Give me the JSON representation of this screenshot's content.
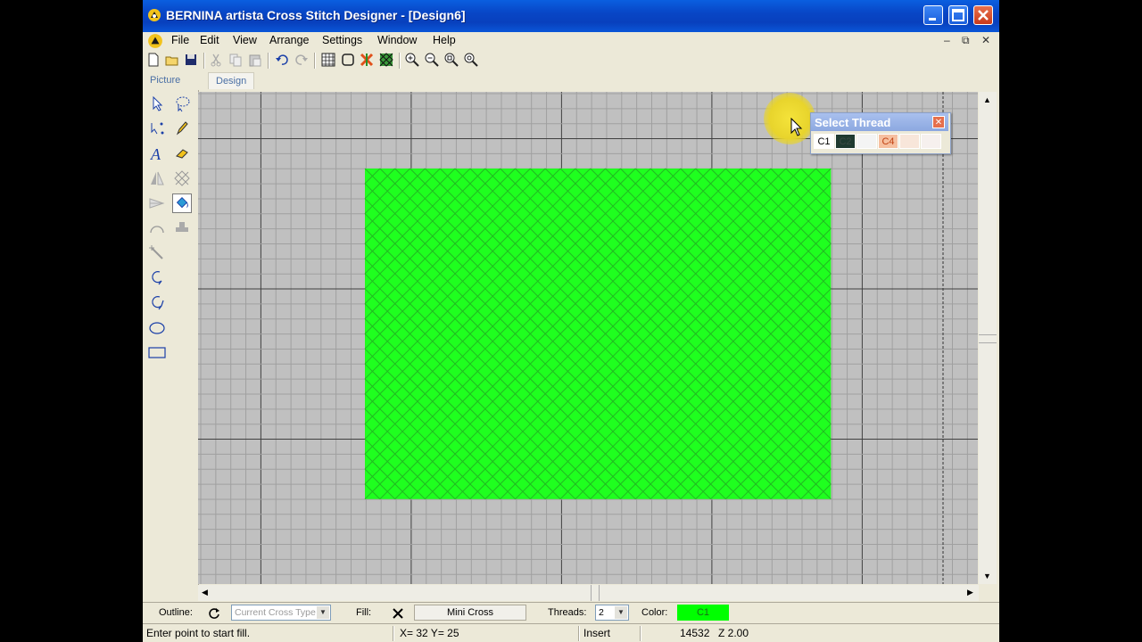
{
  "window": {
    "title": "BERNINA artista Cross Stitch Designer - [Design6]"
  },
  "menu": [
    "File",
    "Edit",
    "View",
    "Arrange",
    "Settings",
    "Window",
    "Help"
  ],
  "toolbar": {
    "icons": [
      "new-file-icon",
      "open-folder-icon",
      "save-icon",
      "cut-icon",
      "copy-icon",
      "paste-icon",
      "undo-icon",
      "redo-icon",
      "grid-icon",
      "hoop-icon",
      "color-icon",
      "pattern-icon",
      "zoom-in-icon",
      "zoom-out-icon",
      "zoom-box-icon",
      "zoom-fit-icon"
    ]
  },
  "view_tabs": [
    "Picture",
    "Design"
  ],
  "active_tab": "Design",
  "tools": [
    "select-arrow-icon",
    "lasso-select-icon",
    "point-select-icon",
    "pencil-icon",
    "text-tool-icon",
    "eraser-icon",
    "mirror-icon",
    "stitch-icon",
    "flip-icon",
    "fill-bucket-icon",
    "arc-icon",
    "stamp-icon",
    "magic-wand-icon",
    "freehand-open-icon",
    "freehand-closed-icon",
    "ellipse-icon",
    "rectangle-icon"
  ],
  "selected_tool": "fill-bucket-icon",
  "canvas": {
    "background": "#c0c0c0",
    "grid_color": "#a0a0a0",
    "major_grid_color": "#404040",
    "stitch_color": "#1fff1f",
    "stitch_line_color": "#22b922",
    "stitched_columns": 31,
    "stitched_rows": 22
  },
  "thread_palette": {
    "title": "Select Thread",
    "swatches": [
      {
        "label": "C1",
        "color": "#ffffff",
        "text_color": "#000000"
      },
      {
        "label": "C2",
        "color": "#1f3a30",
        "text_color": "#3a4a44"
      },
      {
        "label": "",
        "color": "#f4f4f4",
        "text_color": "#000000"
      },
      {
        "label": "C4",
        "color": "#f6c0a0",
        "text_color": "#c04010"
      },
      {
        "label": "",
        "color": "#f8e6da",
        "text_color": "#000000"
      },
      {
        "label": "",
        "color": "#f6f0ee",
        "text_color": "#000000"
      }
    ]
  },
  "property_bar": {
    "outline_label": "Outline:",
    "cross_type_placeholder": "Current Cross Type",
    "fill_label": "Fill:",
    "mini_cross_label": "Mini Cross",
    "threads_label": "Threads:",
    "threads_value": "2",
    "color_label": "Color:",
    "color_value": "C1",
    "color_swatch": "#00ff00"
  },
  "status_bar": {
    "prompt": "Enter point to start fill.",
    "coordinates": "X= 32  Y= 25",
    "mode": "Insert",
    "stitch_count": "14532",
    "zoom": "Z 2.00"
  }
}
